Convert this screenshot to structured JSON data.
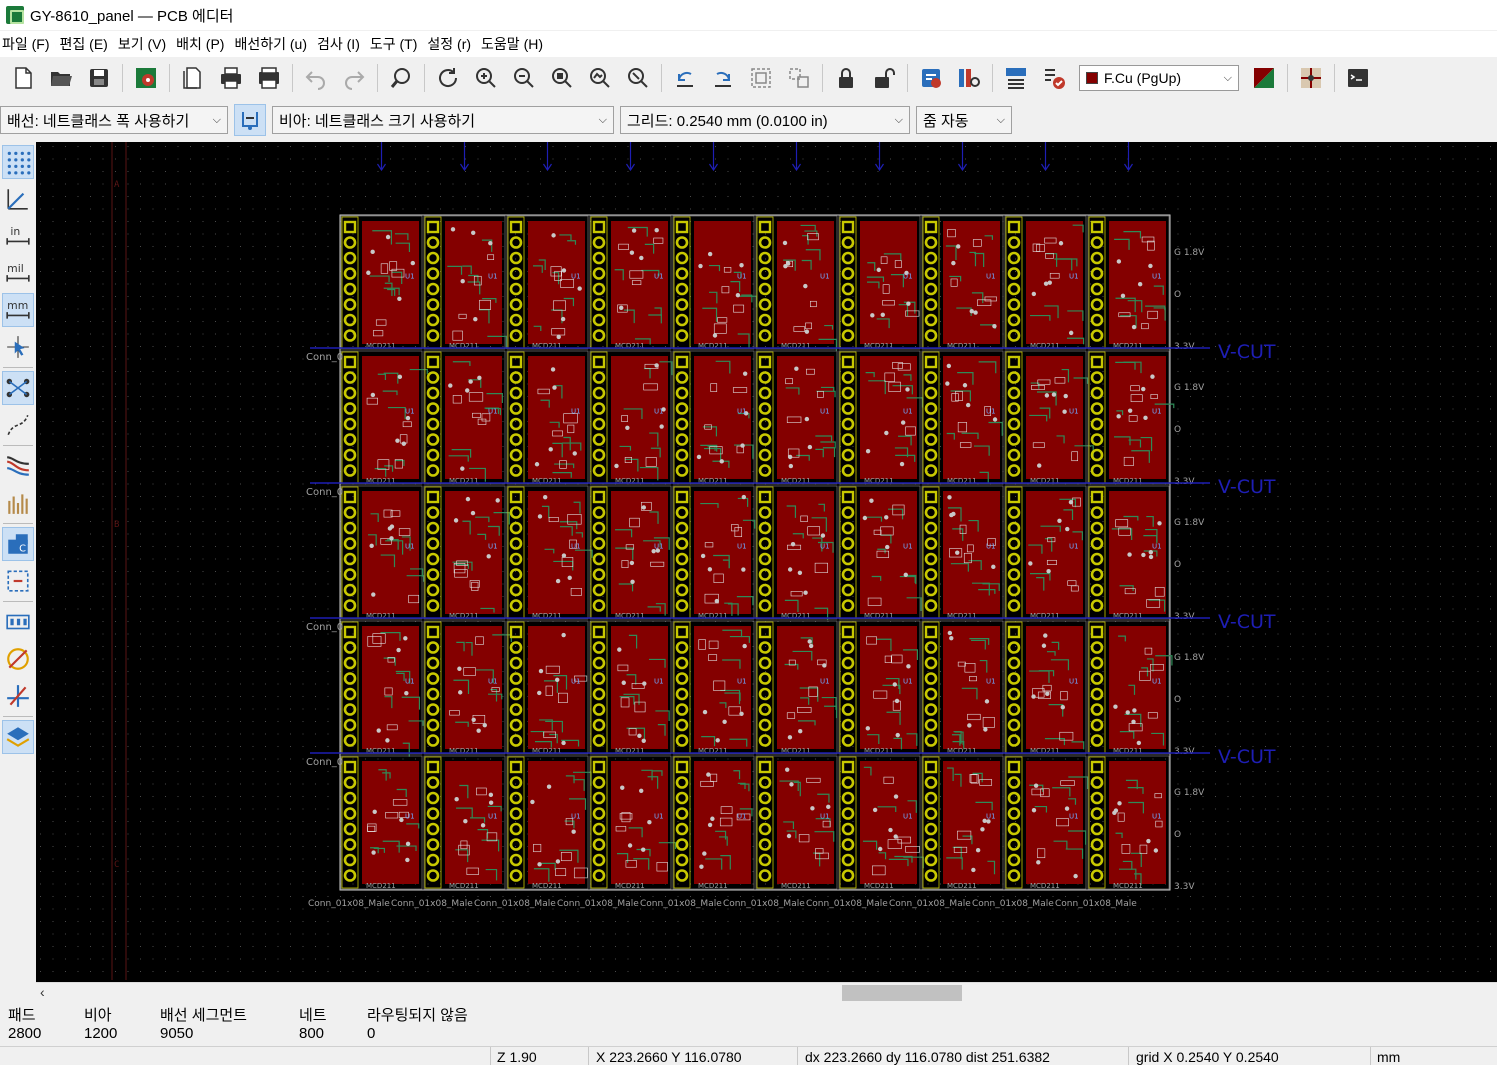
{
  "window": {
    "title": "GY-8610_panel — PCB 에디터"
  },
  "menu": [
    {
      "label": "파일 (F)"
    },
    {
      "label": "편집 (E)"
    },
    {
      "label": "보기 (V)"
    },
    {
      "label": "배치 (P)"
    },
    {
      "label": "배선하기 (u)"
    },
    {
      "label": "검사 (I)"
    },
    {
      "label": "도구 (T)"
    },
    {
      "label": "설정 (r)"
    },
    {
      "label": "도움말 (H)"
    }
  ],
  "toolbar": {
    "layer_selector": "F.Cu (PgUp)",
    "layer_color": "#840000",
    "icons": [
      "new-board-icon",
      "open-icon",
      "save-icon",
      "board-setup-icon",
      "page-settings-icon",
      "print-icon",
      "plot-icon",
      "undo-icon",
      "redo-icon",
      "find-icon",
      "redraw-icon",
      "zoom-in-icon",
      "zoom-out-icon",
      "zoom-fit-icon",
      "zoom-objects-icon",
      "zoom-area-icon",
      "rotate-ccw-icon",
      "rotate-cw-icon",
      "group-icon",
      "ungroup-icon",
      "lock-icon",
      "unlock-icon",
      "footprint-editor-icon",
      "footprint-browser-icon",
      "netlist-icon",
      "drc-icon",
      "layer-pair-icon",
      "scripting-icon",
      "python-console-icon"
    ]
  },
  "auxbar": {
    "track_width": "배선: 네트클래스 폭 사용하기",
    "via_size": "비아: 네트클래스 크기 사용하기",
    "grid": "그리드: 0.2540 mm (0.0100 in)",
    "zoom": "줌 자동"
  },
  "canvas": {
    "board_labels": {
      "vcut": "V-CUT",
      "rail_labels": [
        "G",
        "1.8V",
        "O",
        "3.3V"
      ],
      "connector_ref": "Conn_01x08_Male",
      "connector_left": "Conn_0",
      "silk_ref": "MCD211",
      "chip": "U1"
    },
    "colors": {
      "background": "#000000",
      "copper": "#840000",
      "pad": "#c8c800",
      "edge": "#d0d0d0",
      "vcut": "#1e1eb4",
      "silk": "#a0a0a0",
      "trace": "#2e8b57"
    },
    "panel": {
      "columns": 10,
      "rows": 5
    }
  },
  "info": {
    "pads_label": "패드",
    "pads": "2800",
    "vias_label": "비아",
    "vias": "1200",
    "segments_label": "배선 세그먼트",
    "segments": "9050",
    "nets_label": "네트",
    "nets": "800",
    "unrouted_label": "라우팅되지 않음",
    "unrouted": "0"
  },
  "status": {
    "zoom": "Z 1.90",
    "xy": "X 223.2660  Y 116.0780",
    "dxy": "dx 223.2660  dy 116.0780  dist 251.6382",
    "grid": "grid X 0.2540  Y 0.2540",
    "units": "mm"
  }
}
